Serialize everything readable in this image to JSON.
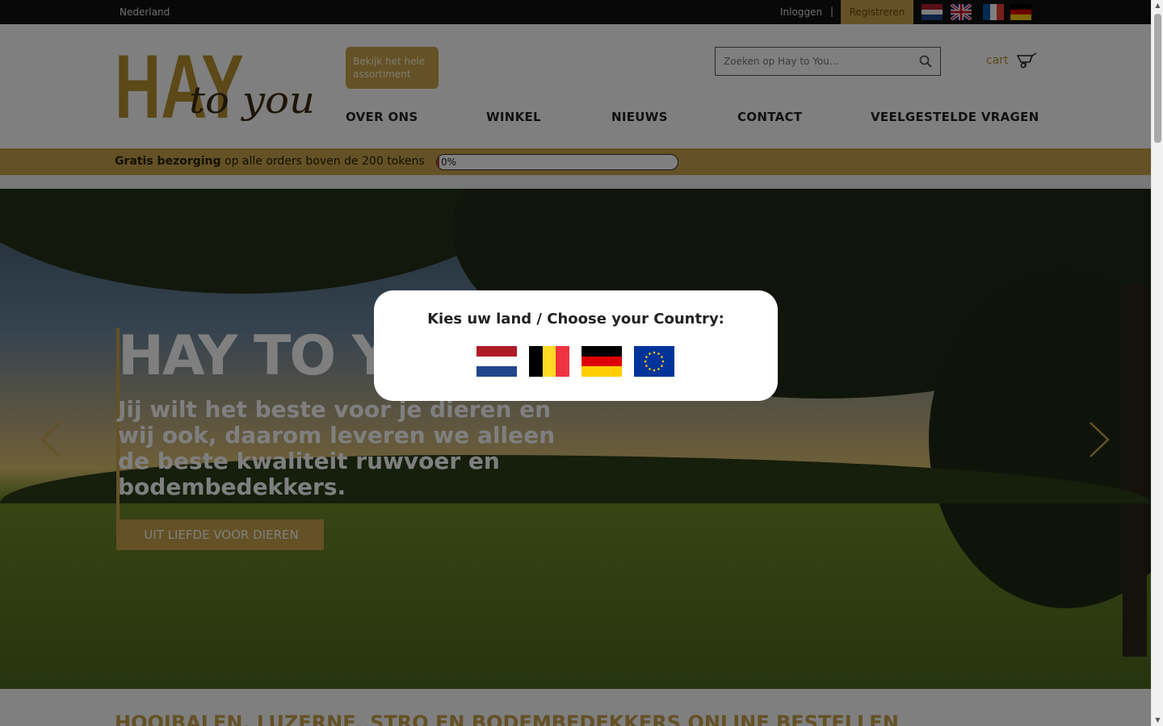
{
  "topbar": {
    "region": "Nederland",
    "login": "Inloggen",
    "separator": "|",
    "register": "Registreren",
    "language_flags": [
      "flag-nl-icon",
      "flag-uk-icon",
      "flag-fr-icon",
      "flag-de-icon"
    ]
  },
  "header": {
    "logo_text": "HAY to you",
    "all_products_button": "Bekijk het hele assortiment",
    "search_placeholder": "Zoeken op Hay to You...",
    "cart_label": "cart",
    "nav": [
      "OVER ONS",
      "WINKEL",
      "NIEUWS",
      "CONTACT",
      "VEELGESTELDE VRAGEN"
    ]
  },
  "free_delivery": {
    "bold": "Gratis bezorging",
    "text": " op alle orders boven de 200 tokens",
    "progress_percent": 0,
    "progress_label": "0%"
  },
  "hero": {
    "title": "HAY TO YOU",
    "subtitle": "Jij wilt het beste voor je dieren en wij ook, daarom leveren we alleen de beste kwaliteit ruwvoer en bodembedekkers.",
    "cta": "UIT LIEFDE VOOR DIEREN"
  },
  "section_heading": "HOOIBALEN, LUZERNE, STRO EN BODEMBEDEKKERS ONLINE BESTELLEN",
  "modal": {
    "title": "Kies uw land / Choose your Country:",
    "countries": [
      "flag-netherlands-icon",
      "flag-belgium-icon",
      "flag-germany-icon",
      "flag-europe-icon"
    ]
  },
  "colors": {
    "brand_gold": "#c9a24a",
    "topbar": "#111111",
    "overlay": "rgba(0,0,0,0.5)"
  }
}
